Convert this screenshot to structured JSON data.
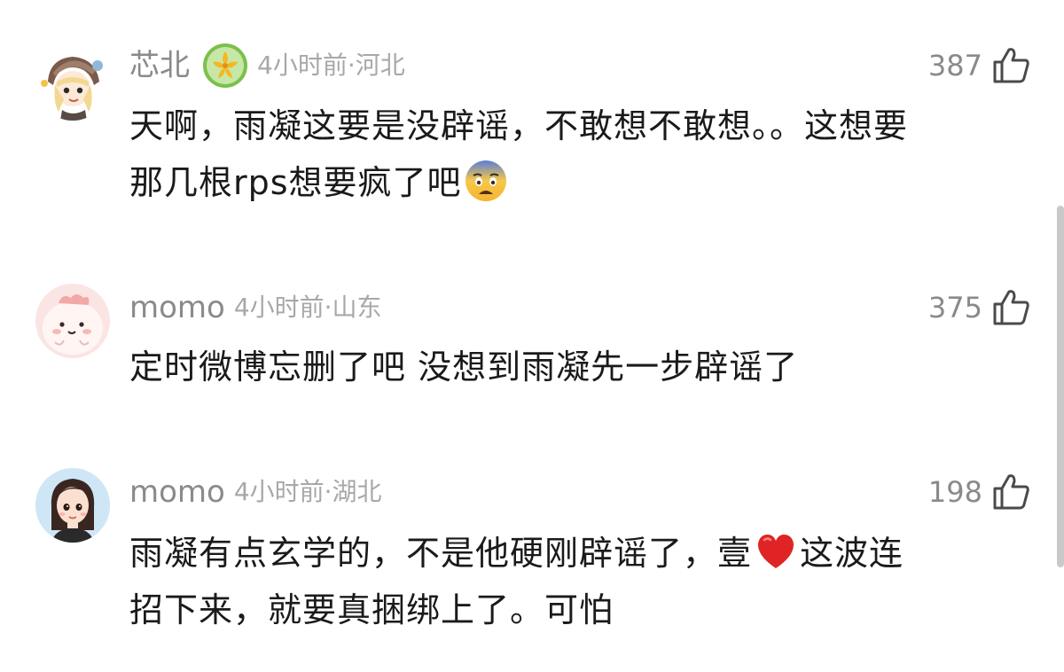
{
  "comments": [
    {
      "username": "芯北",
      "avatar": "anime-girl-avatar",
      "badge": "golden-flower-badge-icon",
      "meta": "4小时前·河北",
      "likes": "387",
      "text_line1": "天啊，雨凝这要是没辟谣，不敢想不敢想。。这想要",
      "text_line2": "那几根rps想要疯了吧",
      "emoji": "fearful-face-emoji"
    },
    {
      "username": "momo",
      "avatar": "pink-blob-avatar",
      "meta": "4小时前·山东",
      "likes": "375",
      "text_line1": "定时微博忘删了吧 没想到雨凝先一步辟谣了"
    },
    {
      "username": "momo",
      "avatar": "cartoon-woman-avatar",
      "meta": "4小时前·湖北",
      "likes": "198",
      "text_line1_a": "雨凝有点玄学的，不是他硬刚辟谣了，壹",
      "emoji": "red-heart-emoji",
      "text_line1_b": "这波连",
      "text_line2": "招下来，就要真捆绑上了。可怕"
    }
  ],
  "colors": {
    "username": "#8a8a8a",
    "meta": "#a8a8a8",
    "text": "#1a1a1a",
    "heart": "#e02424",
    "badge_bg": "#7cc04b",
    "badge_flower": "#f5b820"
  }
}
